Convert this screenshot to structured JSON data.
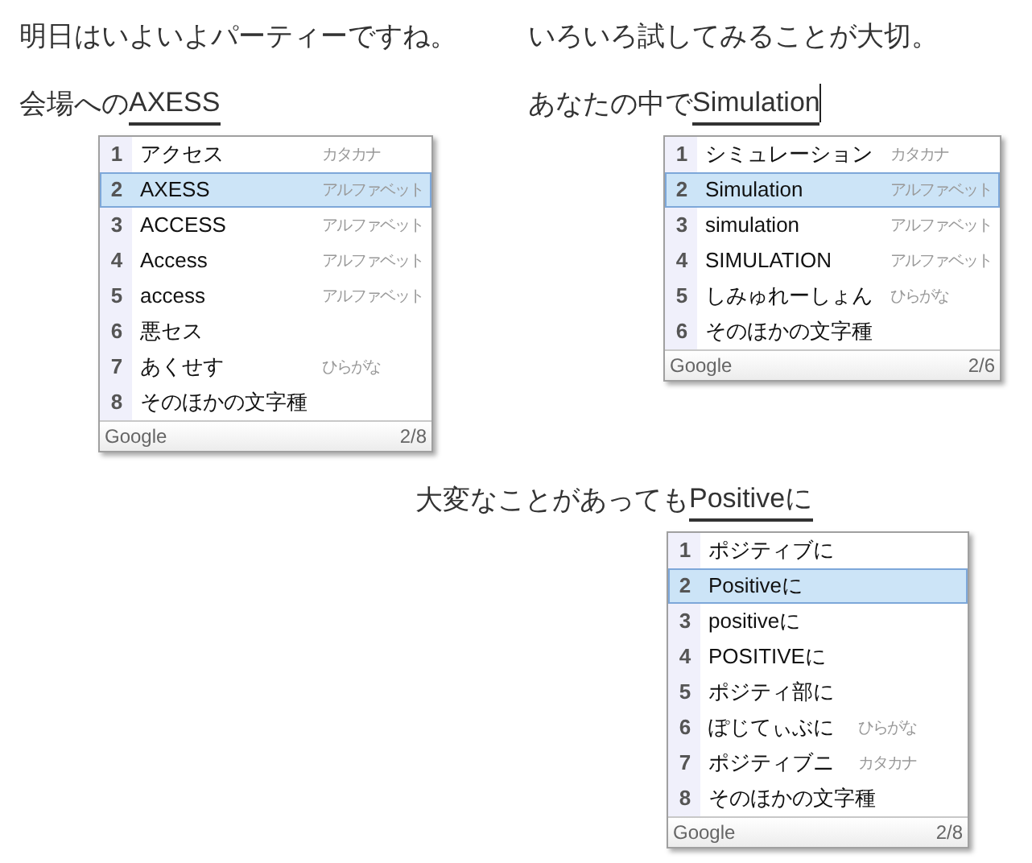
{
  "compositions": [
    {
      "context": "明日はいよいよパーティーですね。",
      "committed": "会場への",
      "preedit": "AXESS",
      "cursor": false,
      "candidates": [
        {
          "number": "1",
          "text": "アクセス",
          "type": "カタカナ",
          "selected": false
        },
        {
          "number": "2",
          "text": "AXESS",
          "type": "アルファベット",
          "selected": true
        },
        {
          "number": "3",
          "text": "ACCESS",
          "type": "アルファベット",
          "selected": false
        },
        {
          "number": "4",
          "text": "Access",
          "type": "アルファベット",
          "selected": false
        },
        {
          "number": "5",
          "text": "access",
          "type": "アルファベット",
          "selected": false
        },
        {
          "number": "6",
          "text": "悪セス",
          "selected": false
        },
        {
          "number": "7",
          "text": "あくせす",
          "type": "ひらがな",
          "selected": false
        },
        {
          "number": "8",
          "text": "そのほかの文字種",
          "selected": false
        }
      ],
      "footer": {
        "source": "Google",
        "position": "2/8"
      }
    },
    {
      "context": "いろいろ試してみることが大切。",
      "committed": "あなたの中で",
      "preedit": "Simulation",
      "cursor": true,
      "candidates": [
        {
          "number": "1",
          "text": "シミュレーション",
          "type": "カタカナ",
          "selected": false
        },
        {
          "number": "2",
          "text": "Simulation",
          "type": "アルファベット",
          "selected": true
        },
        {
          "number": "3",
          "text": "simulation",
          "type": "アルファベット",
          "selected": false
        },
        {
          "number": "4",
          "text": "SIMULATION",
          "type": "アルファベット",
          "selected": false
        },
        {
          "number": "5",
          "text": "しみゅれーしょん",
          "type": "ひらがな",
          "selected": false
        },
        {
          "number": "6",
          "text": "そのほかの文字種",
          "selected": false
        }
      ],
      "footer": {
        "source": "Google",
        "position": "2/6"
      }
    },
    {
      "committed": "大変なことがあっても",
      "preedit": "Positiveに",
      "cursor": false,
      "candidates": [
        {
          "number": "1",
          "text": "ポジティブに",
          "selected": false
        },
        {
          "number": "2",
          "text": "Positiveに",
          "selected": true
        },
        {
          "number": "3",
          "text": "positiveに",
          "selected": false
        },
        {
          "number": "4",
          "text": "POSITIVEに",
          "selected": false
        },
        {
          "number": "5",
          "text": "ポジティ部に",
          "selected": false
        },
        {
          "number": "6",
          "text": "ぽじてぃぶに",
          "type": "ひらがな",
          "selected": false
        },
        {
          "number": "7",
          "text": "ポジティブニ",
          "type": "カタカナ",
          "selected": false
        },
        {
          "number": "8",
          "text": "そのほかの文字種",
          "selected": false
        }
      ],
      "footer": {
        "source": "Google",
        "position": "2/8"
      }
    }
  ]
}
